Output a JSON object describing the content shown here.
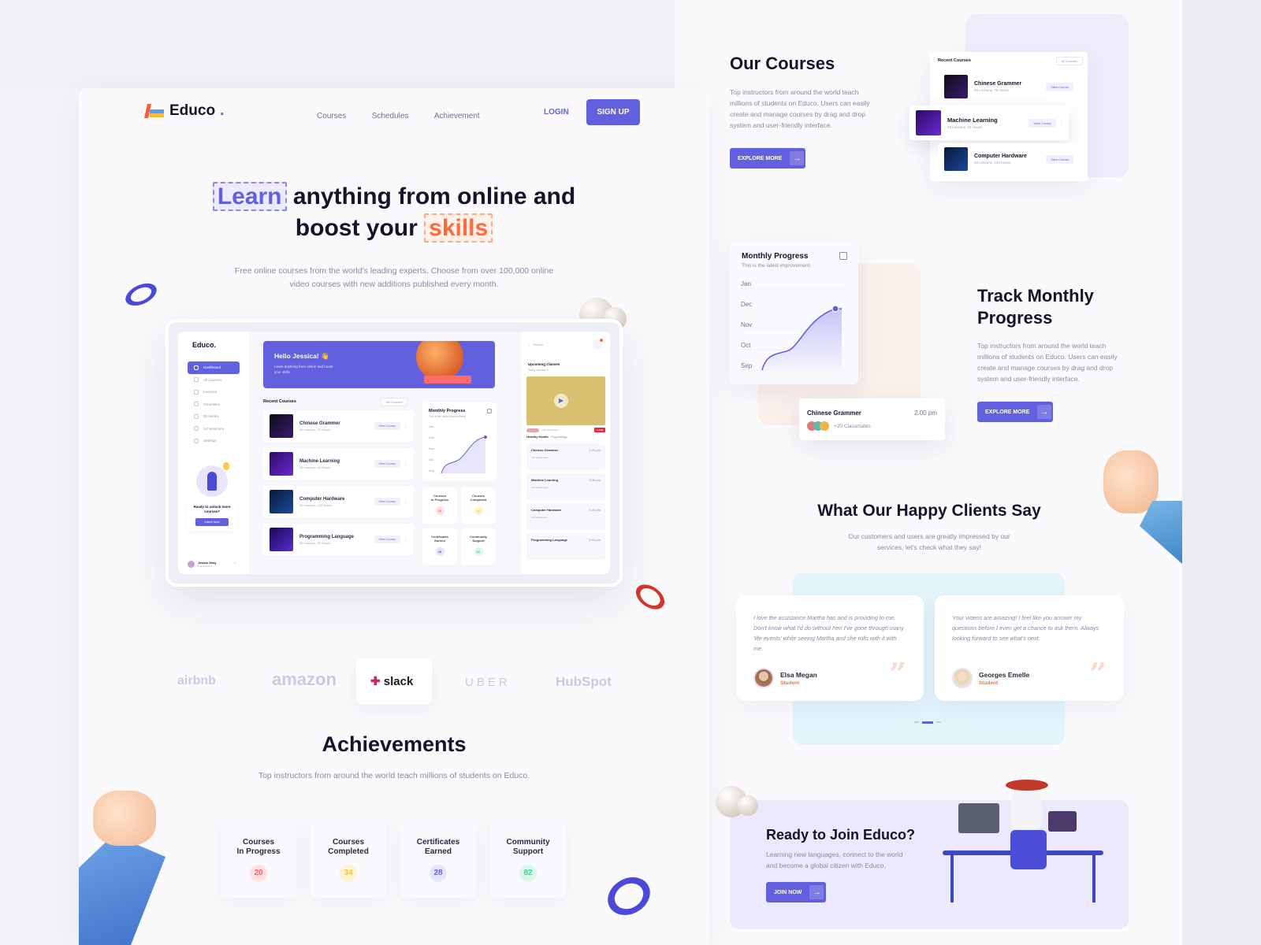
{
  "nav": {
    "brand": "Educo",
    "brand_dot": ".",
    "links": [
      "Courses",
      "Schedules",
      "Achievement"
    ],
    "login": "LOGIN",
    "signup": "SIGN UP"
  },
  "hero": {
    "title_highlight_1": "Learn",
    "title_part_1": " anything from online and",
    "title_part_2": "boost your ",
    "title_highlight_2": "skills",
    "subtitle": "Free online courses from the world's leading experts. Choose from over 100,000 online video courses with new additions published every month."
  },
  "dashboard": {
    "brand": "Educo.",
    "sidebar": [
      "Dashboard",
      "All Courses",
      "Lectures",
      "Schedules",
      "Dictionary",
      "Achievement",
      "Settings"
    ],
    "promo_title": "Ready to unlock more courses?",
    "promo_button": "Unlock Now!",
    "user_name": "Jessica Jessy",
    "user_sub": "Free account",
    "greeting": "Hello Jessica! 👋",
    "greeting_sub": "Learn anything from online and boost your skills.",
    "recent_title": "Recent Courses",
    "filter": "All Courses",
    "view_course": "View Course",
    "courses": [
      {
        "title": "Chinese Grammer",
        "meta": "30 Lessons, 70 Hours"
      },
      {
        "title": "Machine Learning",
        "meta": "28 Lessons, 64 Hours"
      },
      {
        "title": "Computer Hardware",
        "meta": "40 Lessons, 120 Hours"
      },
      {
        "title": "Programming Language",
        "meta": "25 Lessons, 90 Hours"
      }
    ],
    "progress_title": "Monthly Progress",
    "progress_sub": "This is the latest improvement.",
    "stats": [
      {
        "label": "Courses In Progress",
        "value": "20"
      },
      {
        "label": "Courses Completed",
        "value": "34"
      },
      {
        "label": "Certificates Earned",
        "value": "28"
      },
      {
        "label": "Community Support",
        "value": "82"
      }
    ],
    "search_placeholder": "Search",
    "upcoming_title": "Upcoming Classes",
    "upcoming_date": "Today January 1",
    "live_classmates": "+40 Classmates",
    "live_badge": "• LIVE",
    "live_course": "Healthy Health",
    "live_category": ". Psychology",
    "classes": [
      {
        "title": "Chinese Grammer",
        "time": "2.00 pm",
        "classmates": "+20 Classmates"
      },
      {
        "title": "Machine Learning",
        "time": "3.30 pm",
        "classmates": "+15 Classmates"
      },
      {
        "title": "Computer Hardware",
        "time": "5.00 pm",
        "classmates": "+8 Classmates"
      },
      {
        "title": "Programming Language",
        "time": "6.00 pm",
        "classmates": ""
      }
    ]
  },
  "brands": [
    "airbnb",
    "amazon",
    "slack",
    "UBER",
    "HubSpot"
  ],
  "achievements": {
    "title": "Achievements",
    "subtitle": "Top instructors from around the world teach millions of students on Educo.",
    "items": [
      {
        "line1": "Courses",
        "line2": "In Progress",
        "value": "20",
        "color": "#ff5e5e",
        "bg": "#ffe1e1"
      },
      {
        "line1": "Courses",
        "line2": "Completed",
        "value": "34",
        "color": "#f5c53a",
        "bg": "#fff3d1"
      },
      {
        "line1": "Certificates",
        "line2": "Earned",
        "value": "28",
        "color": "#6360e0",
        "bg": "#e6e5fb"
      },
      {
        "line1": "Community",
        "line2": "Support",
        "value": "82",
        "color": "#3ed598",
        "bg": "#dcf7ea"
      }
    ]
  },
  "our_courses": {
    "title": "Our Courses",
    "text": "Top instructors from around the world teach millions of students on Educo. Users can easily create and manage courses by drag and drop system and user-friendly interface.",
    "button": "EXPLORE MORE",
    "card_title": "Recent Courses",
    "card_filter": "All Courses",
    "view_course": "View Course",
    "courses": [
      {
        "title": "Chinese Grammer",
        "meta": "30 Lessons, 70 Hours"
      },
      {
        "title": "Machine Learning",
        "meta": "28 Lessons, 64 Hours"
      },
      {
        "title": "Computer Hardware",
        "meta": "40 Lessons, 120 Hours"
      }
    ]
  },
  "monthly": {
    "card_title": "Monthly Progress",
    "card_sub": "This is the latest improvement.",
    "months": [
      "Jan",
      "Dec",
      "Nov",
      "Oct",
      "Sep"
    ],
    "class_title": "Chinese Grammer",
    "class_time": "2.00 pm",
    "class_classmates": "+20 Classmates",
    "title_1": "Track Monthly",
    "title_2": "Progress",
    "text": "Top instructors from around the world teach millions of students on Educo. Users can easily create and manage courses by drag and drop system and user-friendly interface.",
    "button": "EXPLORE MORE"
  },
  "testimonials": {
    "title": "What Our Happy Clients Say",
    "subtitle": "Our customers and users are greatly impressed by our services, let's check what they say!",
    "items": [
      {
        "quote": "I love the assistance Martha has and is providing to me. Don't know what I'd do without her! I've gone through many 'life events' while seeing Martha and she rolls with it with me.",
        "name": "Elsa Megan",
        "role": "Student"
      },
      {
        "quote": "Your videos are amazing! I feel like you answer my questions before I even get a chance to ask them. Always looking forward to see what's next.",
        "name": "Georges Emelle",
        "role": "Student"
      }
    ]
  },
  "cta": {
    "title": "Ready to Join Educo?",
    "text": "Learning new languages, connect to the world and become a global citizen with Educo.",
    "button": "JOIN NOW"
  },
  "colors": {
    "accent": "#6360e0",
    "orange": "#ff6b3d",
    "dark": "#14142b"
  }
}
